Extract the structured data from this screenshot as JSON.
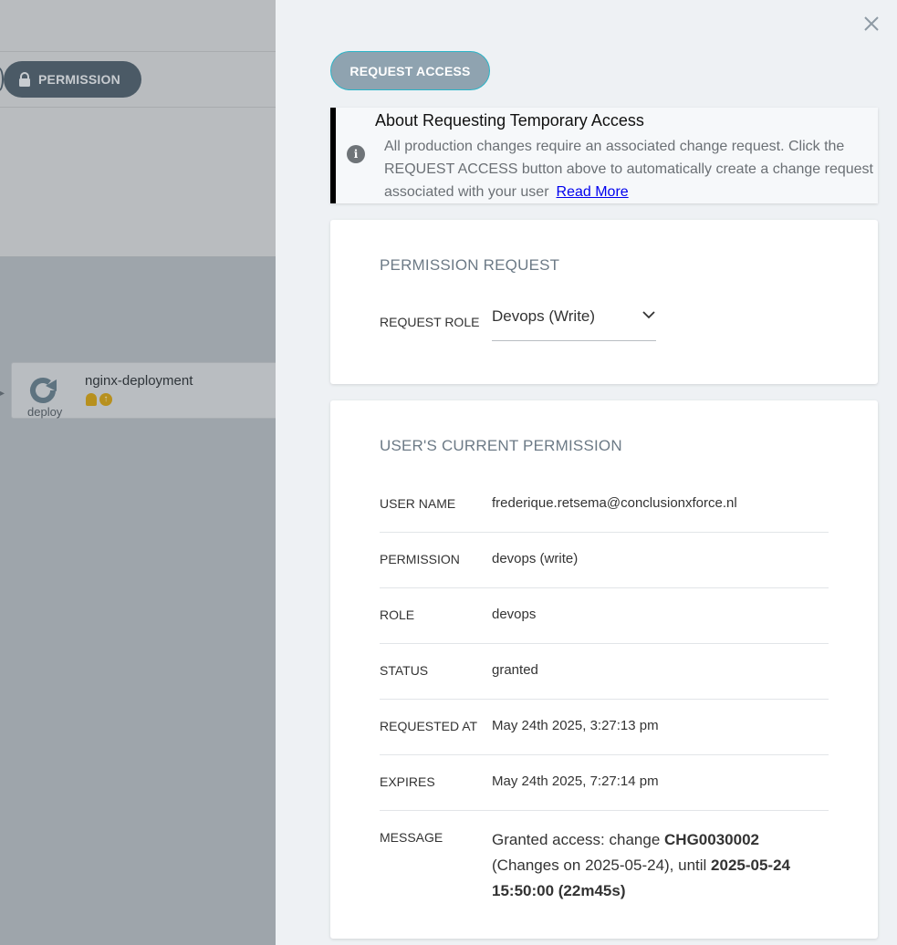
{
  "background": {
    "toolbar": {
      "permission_label": "PERMISSION"
    },
    "node": {
      "name": "nginx-deployment",
      "kind": "deploy"
    }
  },
  "drawer": {
    "request_button": "REQUEST ACCESS",
    "info": {
      "title": "About Requesting Temporary Access",
      "text": "All production changes require an associated change request. Click the REQUEST ACCESS button above to automatically create a change request associated with your user",
      "link": "Read More"
    },
    "permission_request": {
      "title": "PERMISSION REQUEST",
      "role_label": "REQUEST ROLE",
      "role_value": "Devops (Write)"
    },
    "current_permission": {
      "title": "USER'S CURRENT PERMISSION",
      "rows": [
        {
          "key": "USER NAME",
          "value": "frederique.retsema@conclusionxforce.nl"
        },
        {
          "key": "PERMISSION",
          "value": "devops (write)"
        },
        {
          "key": "ROLE",
          "value": "devops"
        },
        {
          "key": "STATUS",
          "value": "granted"
        },
        {
          "key": "REQUESTED AT",
          "value": "May 24th 2025, 3:27:13 pm"
        },
        {
          "key": "EXPIRES",
          "value": "May 24th 2025, 7:27:14 pm"
        }
      ],
      "message": {
        "key": "MESSAGE",
        "prefix": "Granted access: change ",
        "change_id": "CHG0030002",
        "middle": " (Changes on 2025-05-24), until ",
        "until": "2025-05-24 15:50:00 (22m45s)"
      }
    }
  },
  "colors": {
    "pill": "#4b5a66",
    "request_button": "#8fa3b0",
    "request_button_border": "#2ab4c7",
    "badge": "#b7901e",
    "link": "#0000ee"
  }
}
